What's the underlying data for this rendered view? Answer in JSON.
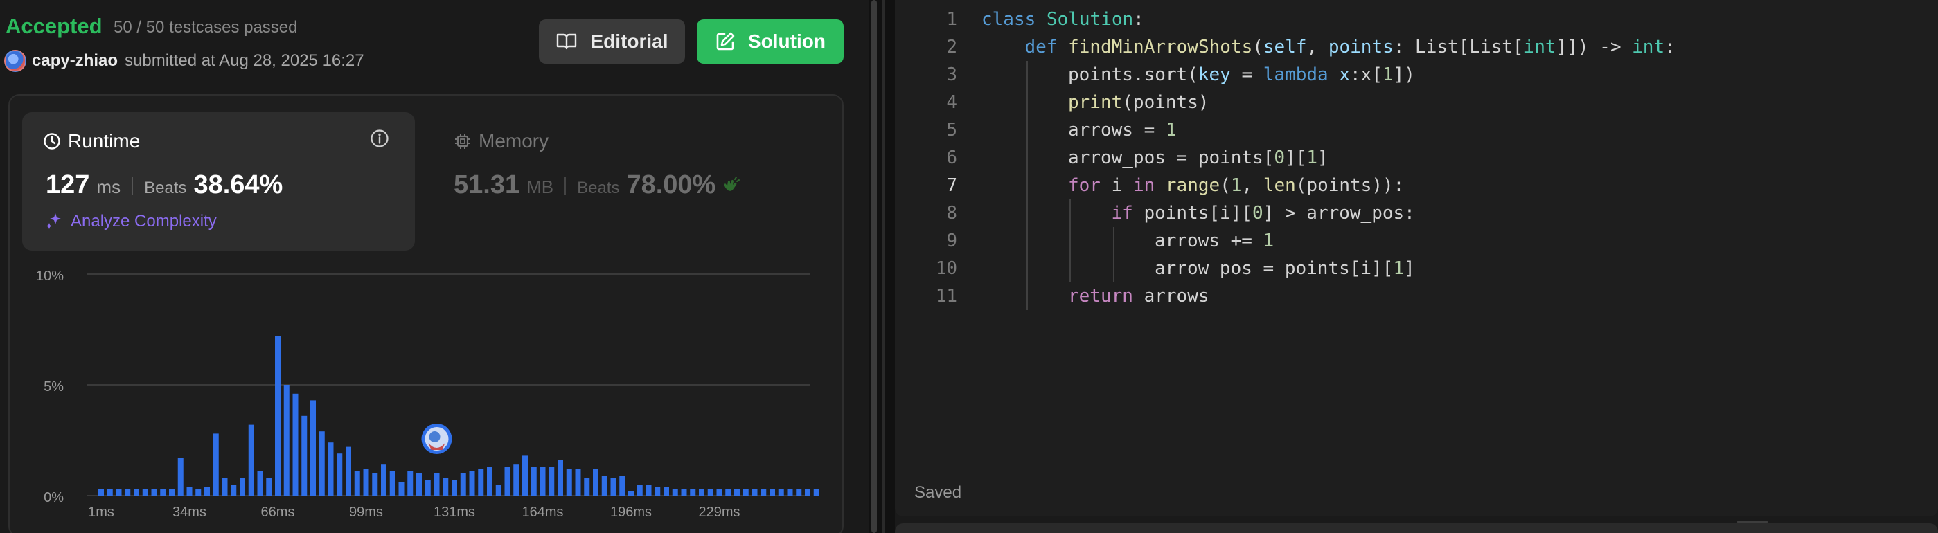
{
  "submission": {
    "status": "Accepted",
    "testcases": "50 / 50 testcases passed",
    "username": "capy-zhiao",
    "submitted_text": "submitted at Aug 28, 2025 16:27"
  },
  "buttons": {
    "editorial": "Editorial",
    "solution": "Solution"
  },
  "runtime": {
    "label": "Runtime",
    "value": "127",
    "unit": "ms",
    "beats_label": "Beats",
    "beats_pct": "38.64%",
    "analyze": "Analyze Complexity"
  },
  "memory": {
    "label": "Memory",
    "value": "51.31",
    "unit": "MB",
    "beats_label": "Beats",
    "beats_pct": "78.00%"
  },
  "colors": {
    "accepted": "#2cbb5d",
    "bar": "#2f6fe8",
    "accent_purple": "#8b6cf0"
  },
  "chart_data": {
    "type": "bar",
    "y_tick_labels": [
      "10%",
      "5%",
      "0%"
    ],
    "ylim": [
      0,
      10
    ],
    "x_tick_labels": [
      "1ms",
      "34ms",
      "66ms",
      "99ms",
      "131ms",
      "164ms",
      "196ms",
      "229ms"
    ],
    "x_tick_indices": [
      0,
      10,
      20,
      30,
      40,
      50,
      60,
      70
    ],
    "highlight_index": 38,
    "values": [
      0.3,
      0.3,
      0.3,
      0.3,
      0.3,
      0.3,
      0.3,
      0.3,
      0.3,
      1.7,
      0.4,
      0.3,
      0.4,
      2.8,
      0.8,
      0.5,
      0.8,
      3.2,
      1.1,
      0.8,
      7.2,
      5.0,
      4.6,
      3.6,
      4.3,
      2.9,
      2.4,
      1.9,
      2.2,
      1.1,
      1.2,
      1.0,
      1.4,
      1.1,
      0.6,
      1.1,
      1.0,
      0.7,
      1.0,
      0.8,
      0.7,
      1.0,
      1.1,
      1.2,
      1.3,
      0.5,
      1.3,
      1.4,
      1.8,
      1.3,
      1.3,
      1.3,
      1.6,
      1.2,
      1.2,
      0.8,
      1.2,
      0.9,
      0.8,
      0.9,
      0.2,
      0.5,
      0.5,
      0.4,
      0.4,
      0.3,
      0.3,
      0.3,
      0.3,
      0.3,
      0.3,
      0.3,
      0.3,
      0.3,
      0.3,
      0.3,
      0.3,
      0.3,
      0.3,
      0.3,
      0.3,
      0.3
    ]
  },
  "editor": {
    "saved": "Saved",
    "lines": [
      {
        "n": "1",
        "indent": 0,
        "tokens": [
          [
            "kw",
            "class "
          ],
          [
            "cls",
            "Solution"
          ],
          [
            "plain",
            ":"
          ]
        ]
      },
      {
        "n": "2",
        "indent": 1,
        "tokens": [
          [
            "kw",
            "def "
          ],
          [
            "fn",
            "findMinArrowShots"
          ],
          [
            "plain",
            "("
          ],
          [
            "param",
            "self"
          ],
          [
            "plain",
            ", "
          ],
          [
            "param",
            "points"
          ],
          [
            "plain",
            ": List[List["
          ],
          [
            "cls",
            "int"
          ],
          [
            "plain",
            "]]) -> "
          ],
          [
            "cls",
            "int"
          ],
          [
            "plain",
            ":"
          ]
        ]
      },
      {
        "n": "3",
        "indent": 2,
        "tokens": [
          [
            "plain",
            "points.sort("
          ],
          [
            "param",
            "key"
          ],
          [
            "plain",
            " = "
          ],
          [
            "kw",
            "lambda "
          ],
          [
            "param",
            "x"
          ],
          [
            "plain",
            ":x["
          ],
          [
            "num",
            "1"
          ],
          [
            "plain",
            "])"
          ]
        ]
      },
      {
        "n": "4",
        "indent": 2,
        "tokens": [
          [
            "fn",
            "print"
          ],
          [
            "plain",
            "(points)"
          ]
        ]
      },
      {
        "n": "5",
        "indent": 2,
        "tokens": [
          [
            "plain",
            "arrows = "
          ],
          [
            "num",
            "1"
          ]
        ]
      },
      {
        "n": "6",
        "indent": 2,
        "tokens": [
          [
            "plain",
            "arrow_pos = points["
          ],
          [
            "num",
            "0"
          ],
          [
            "plain",
            "]["
          ],
          [
            "num",
            "1"
          ],
          [
            "plain",
            "]"
          ]
        ]
      },
      {
        "n": "7",
        "indent": 2,
        "tokens": [
          [
            "kw2",
            "for "
          ],
          [
            "plain",
            "i "
          ],
          [
            "kw2",
            "in "
          ],
          [
            "fn",
            "range"
          ],
          [
            "plain",
            "("
          ],
          [
            "num",
            "1"
          ],
          [
            "plain",
            ", "
          ],
          [
            "fn",
            "len"
          ],
          [
            "plain",
            "(points)):"
          ]
        ]
      },
      {
        "n": "8",
        "indent": 3,
        "tokens": [
          [
            "kw2",
            "if "
          ],
          [
            "plain",
            "points[i]["
          ],
          [
            "num",
            "0"
          ],
          [
            "plain",
            "] > arrow_pos:"
          ]
        ]
      },
      {
        "n": "9",
        "indent": 4,
        "tokens": [
          [
            "plain",
            "arrows += "
          ],
          [
            "num",
            "1"
          ]
        ]
      },
      {
        "n": "10",
        "indent": 4,
        "tokens": [
          [
            "plain",
            "arrow_pos = points[i]["
          ],
          [
            "num",
            "1"
          ],
          [
            "plain",
            "]"
          ]
        ]
      },
      {
        "n": "11",
        "indent": 2,
        "tokens": [
          [
            "kw2",
            "return "
          ],
          [
            "plain",
            "arrows"
          ]
        ]
      }
    ],
    "active_line": "7"
  }
}
